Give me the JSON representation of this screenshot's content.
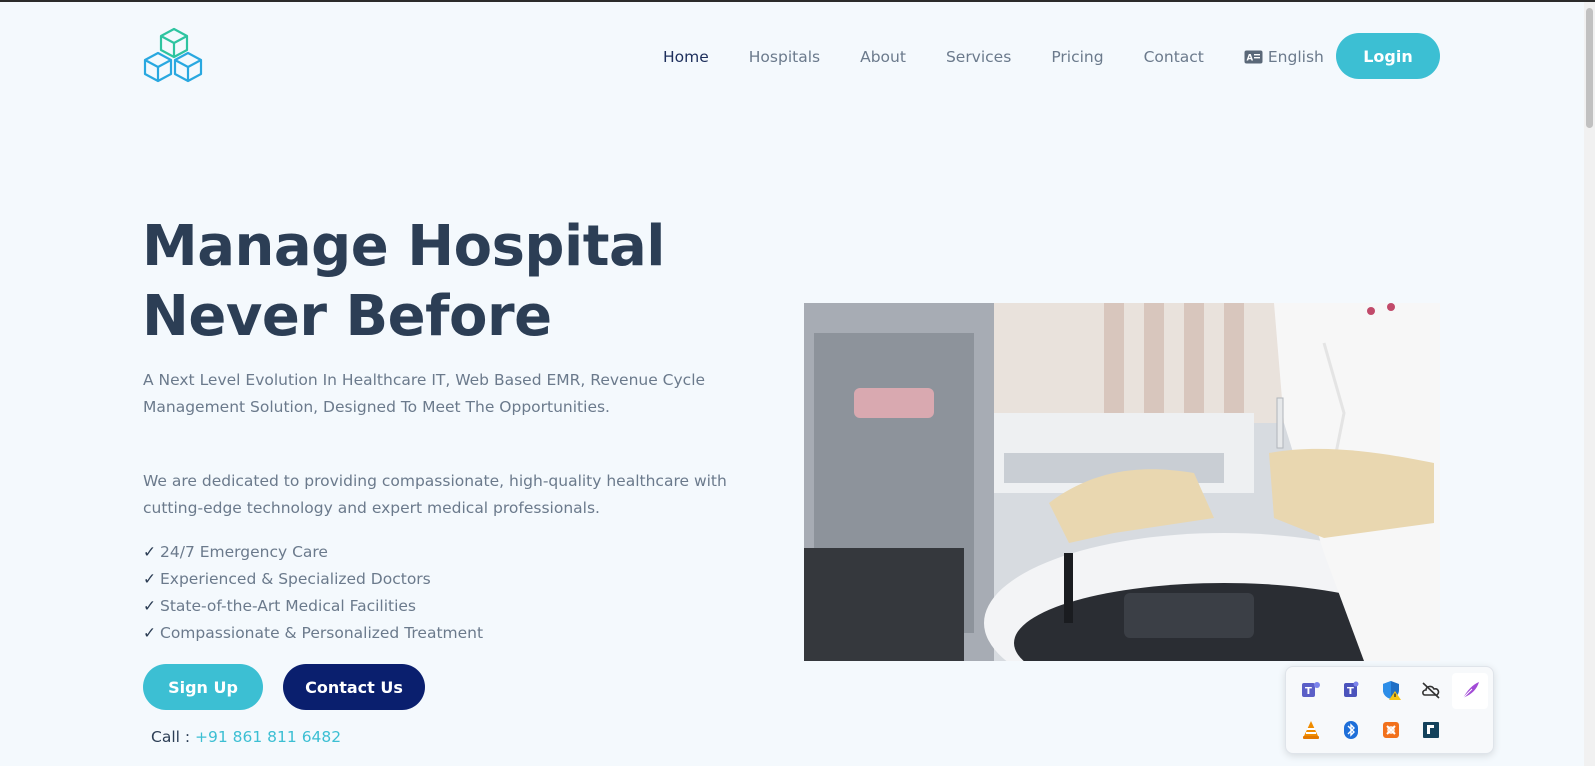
{
  "nav": {
    "items": [
      {
        "label": "Home",
        "active": true
      },
      {
        "label": "Hospitals"
      },
      {
        "label": "About"
      },
      {
        "label": "Services"
      },
      {
        "label": "Pricing"
      },
      {
        "label": "Contact"
      }
    ],
    "language": "English",
    "login_label": "Login"
  },
  "hero": {
    "title_line1": "Manage Hospital",
    "title_line2": "Never Before",
    "subtitle": "A Next Level Evolution In Healthcare IT, Web Based EMR, Revenue Cycle Management Solution, Designed To Meet The Opportunities.",
    "description": "We are dedicated to providing compassionate, high-quality healthcare with cutting-edge technology and expert medical professionals.",
    "check_mark": "✓",
    "features": [
      "24/7 Emergency Care",
      "Experienced & Specialized Doctors",
      "State-of-the-Art Medical Facilities",
      "Compassionate & Personalized Treatment"
    ],
    "signup_label": "Sign Up",
    "contact_label": "Contact Us",
    "call_label": "Call :",
    "phone": "+91 861 811 6482"
  },
  "tray_icons": [
    "teams-icon",
    "teams-classic-icon",
    "defender-warning-icon",
    "onedrive-off-icon",
    "feather-pen-icon",
    "vlc-icon",
    "bluetooth-icon",
    "xampp-icon",
    "remote-desktop-icon"
  ],
  "colors": {
    "accent": "#3cbfd3",
    "navy": "#0a1f6e",
    "heading": "#2c3e55",
    "muted": "#6b7a8c",
    "background": "#f4f9fd"
  }
}
